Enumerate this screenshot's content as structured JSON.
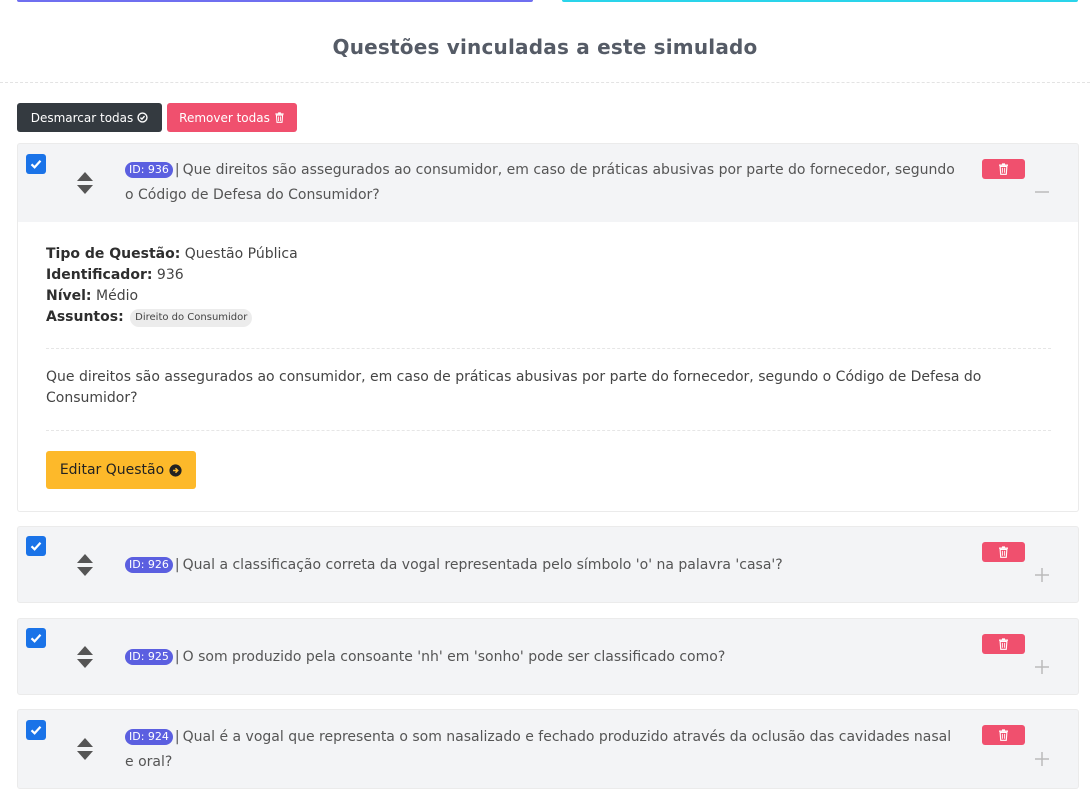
{
  "page": {
    "title": "Questões vinculadas a este simulado"
  },
  "toolbar": {
    "uncheck_all_label": "Desmarcar todas",
    "remove_all_label": "Remover todas"
  },
  "colors": {
    "accent_primary": "#5b5fe0",
    "danger": "#f0506e",
    "warning": "#fdb92a",
    "dark": "#343a40",
    "checkbox": "#1a73e8"
  },
  "questions": [
    {
      "id_label": "ID: 936",
      "text": "Que direitos são assegurados ao consumidor, em caso de práticas abusivas por parte do fornecedor, segundo o Código de Defesa do Consumidor?",
      "checked": true,
      "expanded": true,
      "toggle_icon": "minus-icon"
    },
    {
      "id_label": "ID: 926",
      "text": "Qual a classificação correta da vogal representada pelo símbolo 'o' na palavra 'casa'?",
      "checked": true,
      "expanded": false,
      "toggle_icon": "plus-icon"
    },
    {
      "id_label": "ID: 925",
      "text": "O som produzido pela consoante 'nh' em 'sonho' pode ser classificado como?",
      "checked": true,
      "expanded": false,
      "toggle_icon": "plus-icon"
    },
    {
      "id_label": "ID: 924",
      "text": "Qual é a vogal que representa o som nasalizado e fechado produzido através da oclusão das cavidades nasal e oral?",
      "checked": true,
      "expanded": false,
      "toggle_icon": "plus-icon"
    }
  ],
  "detail": {
    "type_label": "Tipo de Questão:",
    "type_value": "Questão Pública",
    "identifier_label": "Identificador:",
    "identifier_value": "936",
    "level_label": "Nível:",
    "level_value": "Médio",
    "subjects_label": "Assuntos:",
    "subjects": [
      "Direito do Consumidor"
    ],
    "question_text": "Que direitos são assegurados ao consumidor, em caso de práticas abusivas por parte do fornecedor, segundo o Código de Defesa do Consumidor?",
    "edit_label": "Editar Questão"
  },
  "icons": {
    "uncheck": "check-circle-icon",
    "trash": "trash-icon",
    "sort": "sort-icon",
    "edit_arrow": "arrow-circle-right-icon"
  }
}
